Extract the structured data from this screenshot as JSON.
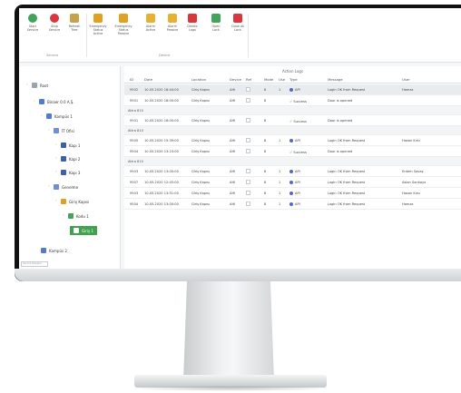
{
  "ribbon": {
    "buttons": [
      {
        "label": "Start\nService",
        "icon": "play-circle-icon",
        "color": "#43a35a"
      },
      {
        "label": "Stop\nService",
        "icon": "stop-circle-icon",
        "color": "#d9363e"
      },
      {
        "label": "Refresh\nTree",
        "icon": "refresh-icon",
        "color": "#c8a24a"
      },
      {
        "label": "Emergency\nStatus Active",
        "icon": "emergency-active-icon",
        "color": "#e0a020"
      },
      {
        "label": "Emergency\nStatus Passive",
        "icon": "emergency-passive-icon",
        "color": "#e0a020"
      },
      {
        "label": "Alarm\nActive",
        "icon": "alarm-active-icon",
        "color": "#e8b030"
      },
      {
        "label": "Alarm\nPassive",
        "icon": "alarm-passive-icon",
        "color": "#e8b030"
      },
      {
        "label": "Delete\nLogs",
        "icon": "delete-logs-icon",
        "color": "#d9363e"
      },
      {
        "label": "Open\nLock",
        "icon": "open-lock-icon",
        "color": "#43a35a"
      },
      {
        "label": "Close All\nLock",
        "icon": "close-all-lock-icon",
        "color": "#d9363e"
      }
    ],
    "groups": [
      "Service",
      "Device"
    ]
  },
  "tree": {
    "items": [
      {
        "label": "Root",
        "indent": 0
      },
      {
        "label": "Binaer 0.0 A.Ş.",
        "indent": 1
      },
      {
        "label": "Kampüs 1",
        "indent": 2
      },
      {
        "label": "İT Ofisi",
        "indent": 3
      },
      {
        "label": "Kapı 1",
        "indent": 4
      },
      {
        "label": "Kapı 2",
        "indent": 4
      },
      {
        "label": "Kapı 3",
        "indent": 4
      },
      {
        "label": "Genelme",
        "indent": 3
      },
      {
        "label": "Giriş Kapısı",
        "indent": 4
      },
      {
        "label": "Kodu 1",
        "indent": 5
      },
      {
        "label": "Giriş 1",
        "indent": 6,
        "selected": true
      },
      {
        "label": "Kampüs 2",
        "indent": 2
      }
    ],
    "status": "Service Stopped"
  },
  "grid": {
    "title": "Action Logs",
    "columns": [
      "ID",
      "Date",
      "Location",
      "Device",
      "Ref",
      "Mode",
      "Use",
      "Type",
      "Message",
      "User"
    ],
    "rows": [
      {
        "kind": "row",
        "highlight": true,
        "id": "9502",
        "date": "10.05.2020 18:44:00",
        "location": "Giriş Kapısı",
        "device": "AHİ",
        "mode": "8",
        "use": "1",
        "type": "API",
        "message": "Login OK from Request",
        "user": "Hamza"
      },
      {
        "kind": "row",
        "id": "9501",
        "date": "10.05.2020 18:00:00",
        "location": "Giriş Kapısı",
        "device": "AHİ",
        "mode": "8",
        "use": "",
        "type": "Success",
        "message": "Door is opened",
        "user": ""
      },
      {
        "kind": "group",
        "label": "Attra 810"
      },
      {
        "kind": "row",
        "id": "9501",
        "date": "10.05.2020 18:00:00",
        "location": "Giriş Kapısı",
        "device": "AHİ",
        "mode": "8",
        "use": "",
        "type": "Success",
        "message": "Door is opened",
        "user": ""
      },
      {
        "kind": "group",
        "label": "Attra 810"
      },
      {
        "kind": "row",
        "id": "9505",
        "date": "10.05.2020 15:39:00",
        "location": "Giriş Kapısı",
        "device": "AHİ",
        "mode": "8",
        "use": "1",
        "type": "API",
        "message": "Login OK from Request",
        "user": "Hasan Kırcı"
      },
      {
        "kind": "row",
        "id": "9504",
        "date": "10.05.2020 13:23:00",
        "location": "Giriş Kapısı",
        "device": "AHİ",
        "mode": "8",
        "use": "",
        "type": "Success",
        "message": "Door is opened",
        "user": ""
      },
      {
        "kind": "group",
        "label": "Attra 810"
      },
      {
        "kind": "row",
        "id": "9503",
        "date": "10.05.2020 13:00:00",
        "location": "Giriş Kapısı",
        "device": "AHİ",
        "mode": "8",
        "use": "1",
        "type": "API",
        "message": "Login OK from Request",
        "user": "Erdem Savaş"
      },
      {
        "kind": "row",
        "id": "9507",
        "date": "10.05.2020 12:45:00",
        "location": "Giriş Kapısı",
        "device": "AHİ",
        "mode": "8",
        "use": "1",
        "type": "API",
        "message": "Login OK from Request",
        "user": "Aslan Sarıkaya"
      },
      {
        "kind": "row",
        "id": "9503",
        "date": "10.05.2020 13:51:00",
        "location": "Giriş Kapısı",
        "device": "AHİ",
        "mode": "8",
        "use": "1",
        "type": "API",
        "message": "Login OK from Request",
        "user": "Hasan Kırcı"
      },
      {
        "kind": "row",
        "id": "9504",
        "date": "10.05.2020 13:00:00",
        "location": "Giriş Kapısı",
        "device": "AHİ",
        "mode": "8",
        "use": "1",
        "type": "API",
        "message": "Login OK from Request",
        "user": "Hamza"
      }
    ]
  },
  "colors": {
    "accent_green": "#3fa34d",
    "type_badge": "#5567c9",
    "success": "#3a9b55"
  }
}
